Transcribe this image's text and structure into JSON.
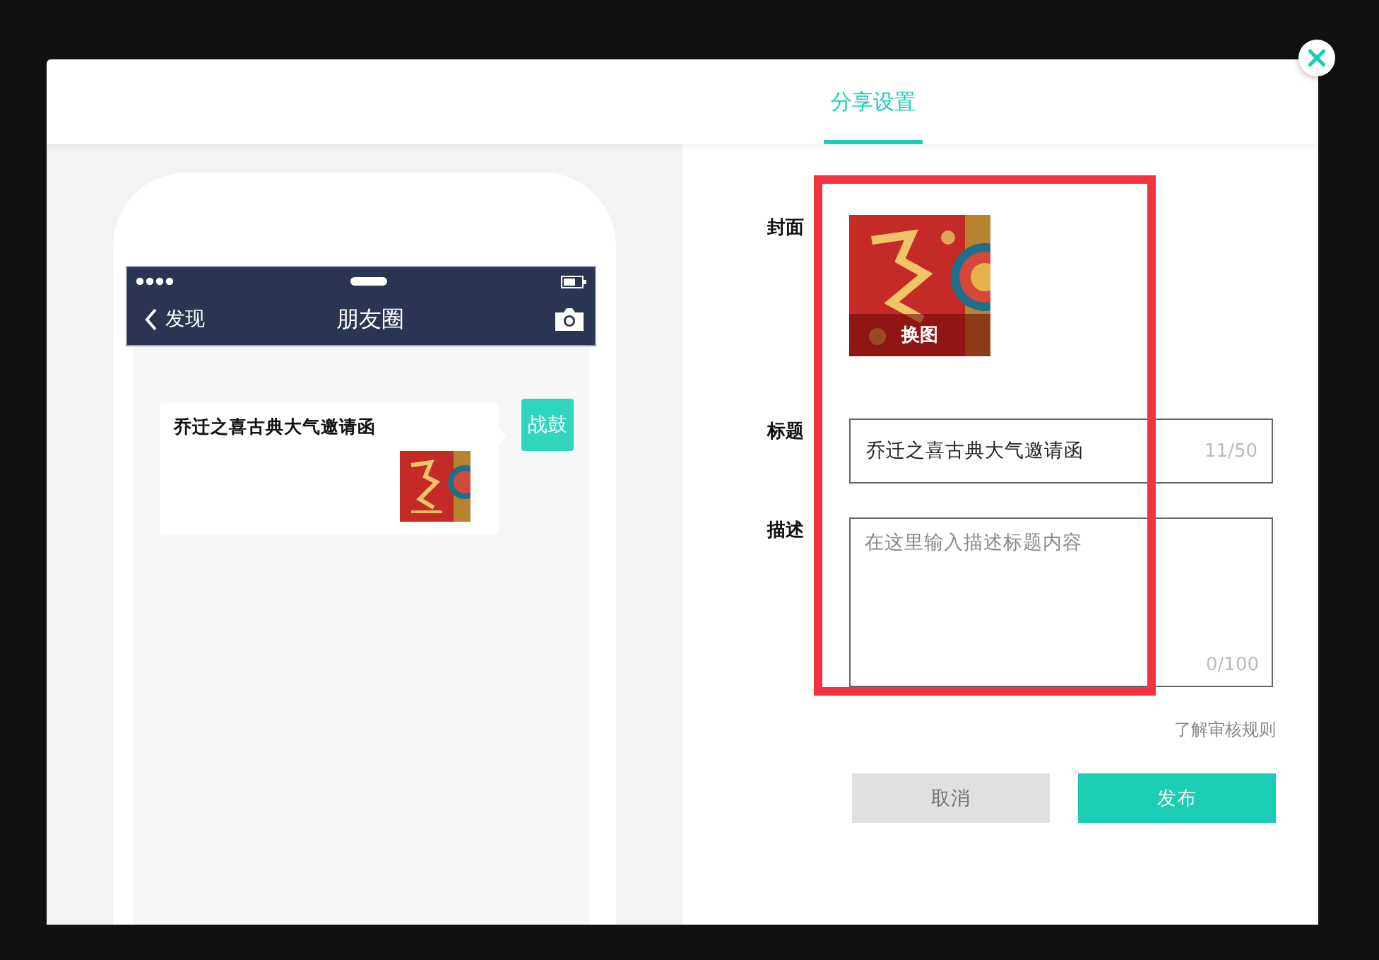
{
  "dialog": {
    "tabs": [
      {
        "label": "分享设置",
        "selected": true
      }
    ]
  },
  "preview": {
    "nav": {
      "back": "发现",
      "title": "朋友圈"
    },
    "post": {
      "avatar_text": "战鼓",
      "title": "乔迁之喜古典大气邀请函"
    }
  },
  "form": {
    "cover": {
      "label": "封面",
      "change_button": "换图"
    },
    "title": {
      "label": "标题",
      "value": "乔迁之喜古典大气邀请函",
      "count": "11/50"
    },
    "description": {
      "label": "描述",
      "placeholder": "在这里输入描述标题内容",
      "count": "0/100"
    },
    "rules_link": "了解审核规则",
    "buttons": [
      {
        "label": "取消",
        "kind": "secondary"
      },
      {
        "label": "发布",
        "kind": "primary"
      }
    ]
  },
  "annotation": {
    "kind": "highlight_box"
  }
}
